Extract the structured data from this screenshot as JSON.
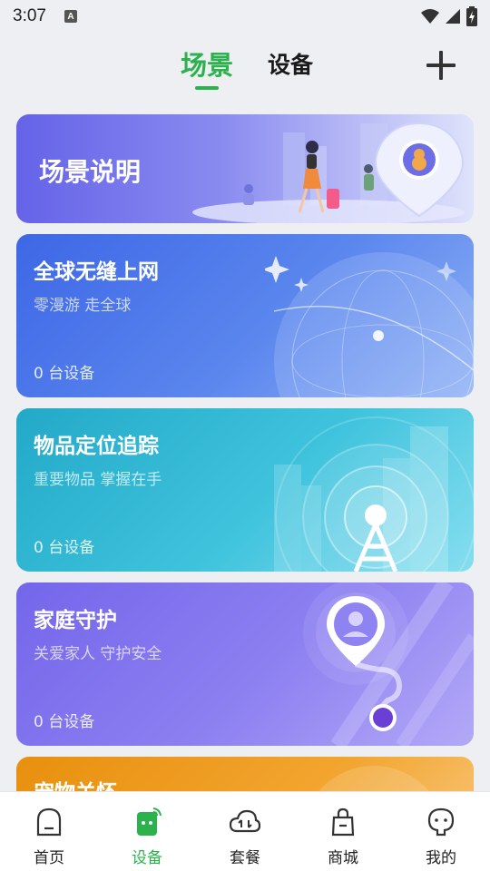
{
  "status_bar": {
    "time": "3:07",
    "notification_icon": "A"
  },
  "header": {
    "tabs": [
      {
        "label": "场景",
        "active": true
      },
      {
        "label": "设备",
        "active": false
      }
    ],
    "add_icon": "plus-icon"
  },
  "banner": {
    "title": "场景说明"
  },
  "scene_cards": [
    {
      "title": "全球无缝上网",
      "subtitle": "零漫游 走全球",
      "count": "0",
      "count_unit": "台设备"
    },
    {
      "title": "物品定位追踪",
      "subtitle": "重要物品 掌握在手",
      "count": "0",
      "count_unit": "台设备"
    },
    {
      "title": "家庭守护",
      "subtitle": "关爱家人 守护安全",
      "count": "0",
      "count_unit": "台设备"
    },
    {
      "title": "宠物关怀"
    }
  ],
  "bottom_nav": [
    {
      "label": "首页",
      "icon": "home-icon",
      "active": false
    },
    {
      "label": "设备",
      "icon": "device-icon",
      "active": true
    },
    {
      "label": "套餐",
      "icon": "cloud-plan-icon",
      "active": false
    },
    {
      "label": "商城",
      "icon": "shopping-bag-icon",
      "active": false
    },
    {
      "label": "我的",
      "icon": "profile-icon",
      "active": false
    }
  ],
  "colors": {
    "accent": "#2bb24c",
    "background": "#eeeff3"
  }
}
